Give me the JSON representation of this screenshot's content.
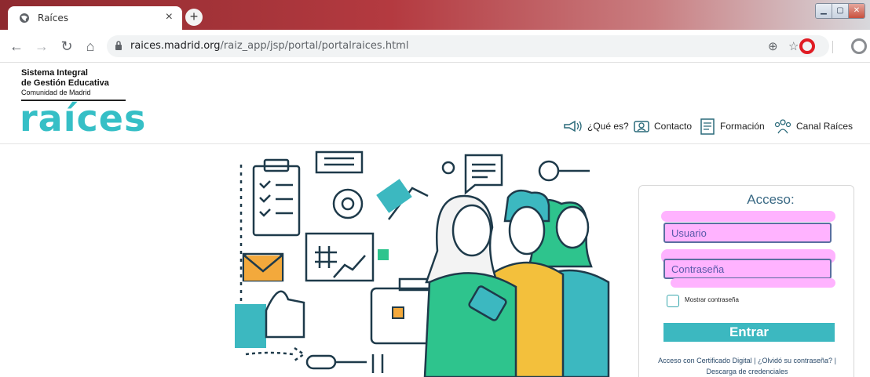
{
  "browser": {
    "tab_title": "Raíces",
    "tab_close": "×",
    "new_tab": "+",
    "url_host": "raices.madrid.org",
    "url_path": "/raiz_app/jsp/portal/portalraices.html",
    "icons": {
      "favicon": "globe-icon",
      "back": "back-arrow-icon",
      "forward": "forward-arrow-icon",
      "reload": "reload-icon",
      "home": "home-icon",
      "lock": "lock-icon",
      "zoom": "zoom-icon",
      "star": "bookmark-star-icon",
      "opera": "opera-icon",
      "profile": "profile-icon"
    },
    "titlebar_colors": {
      "accent": "#b43a40"
    }
  },
  "header": {
    "brand_line1": "Sistema Integral",
    "brand_line2": "de Gestión Educativa",
    "brand_line3": "Comunidad de Madrid",
    "logo_word": "raíces",
    "logo_color": "#36bfc6"
  },
  "topnav": {
    "items": [
      {
        "label": "¿Qué es?",
        "icon": "megaphone-icon"
      },
      {
        "label": "Contacto",
        "icon": "contact-card-icon"
      },
      {
        "label": "Formación",
        "icon": "document-icon"
      },
      {
        "label": "Canal Raíces",
        "icon": "people-icon"
      }
    ]
  },
  "login": {
    "title": "Acceso:",
    "username_placeholder": "Usuario",
    "password_placeholder": "Contraseña",
    "show_password_label": "Mostrar contraseña",
    "submit_label": "Entrar",
    "link_cert": "Acceso con Certificado Digital",
    "link_sep1": "|",
    "link_forgot": "¿Olvidó su contraseña?",
    "link_sep2": "|",
    "link_download": "Descarga de credenciales",
    "colors": {
      "button": "#3cb8c0",
      "field_highlight": "#ffb3ff",
      "title": "#3b6a85"
    }
  }
}
